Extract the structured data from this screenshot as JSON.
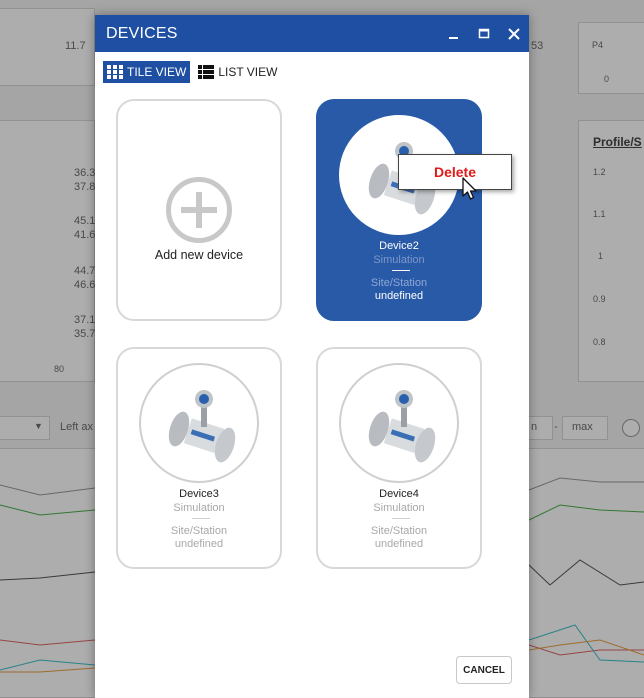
{
  "background": {
    "texts": [
      "11.7",
      "53",
      "P4",
      "0",
      "Profile/S",
      "1.2",
      "1.1",
      "1",
      "0.9",
      "0.8",
      "36.3",
      "37.8",
      "45.1",
      "41.6",
      "44.7",
      "46.6",
      "37.1",
      "35.7",
      "80",
      "Left ax",
      "n",
      "max"
    ]
  },
  "dialog": {
    "title": "DEVICES",
    "minimize_icon": "minimize-icon",
    "maximize_icon": "maximize-icon",
    "close_icon": "close-icon",
    "view_toggle": {
      "tile_label": "TILE VIEW",
      "list_label": "LIST VIEW",
      "active": "tile"
    },
    "add_tile": {
      "label": "Add new device"
    },
    "devices": [
      {
        "name": "Device2",
        "type": "Simulation",
        "site_label": "Site/Station",
        "site_value": "undefined",
        "selected": true
      },
      {
        "name": "Device3",
        "type": "Simulation",
        "site_label": "Site/Station",
        "site_value": "undefined",
        "selected": false
      },
      {
        "name": "Device4",
        "type": "Simulation",
        "site_label": "Site/Station",
        "site_value": "undefined",
        "selected": false
      }
    ],
    "context_menu": {
      "delete_label": "Delete"
    },
    "cancel_label": "CANCEL"
  },
  "colors": {
    "accent": "#1f4fa3",
    "selected_tile": "#285aa8",
    "delete": "#e01a1a"
  }
}
